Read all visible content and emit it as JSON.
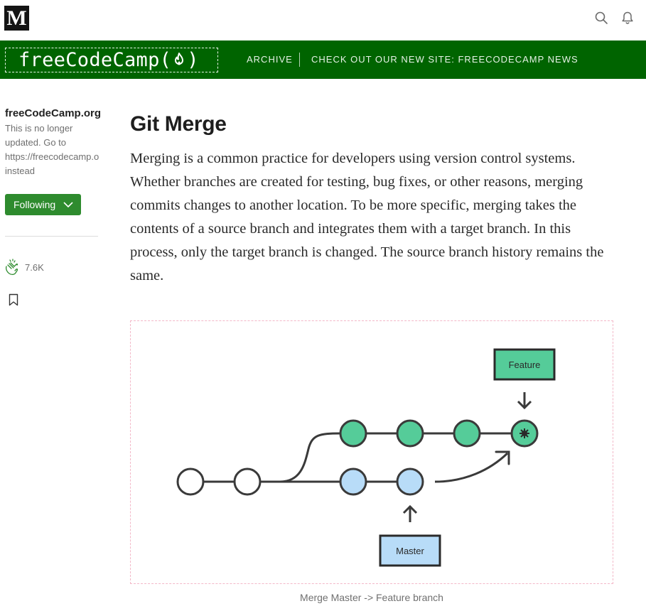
{
  "topbar": {
    "logo_letter": "M",
    "icons": [
      "search-icon",
      "bell-icon"
    ]
  },
  "navbar": {
    "brand_left": "freeCodeCamp(",
    "brand_right": ")",
    "brand_icon": "flame-icon",
    "links": [
      "ARCHIVE",
      "CHECK OUT OUR NEW SITE: FREECODECAMP NEWS"
    ],
    "color": "#006400"
  },
  "sidebar": {
    "publication": "freeCodeCamp.org",
    "description_lines": [
      "This is no longer",
      "updated. Go to",
      "https://freecodecamp.org/news",
      "instead"
    ],
    "follow_label": "Following",
    "clap_count": "7.6K",
    "accent": "#2e8b2e"
  },
  "article": {
    "title": "Git Merge",
    "paragraph": "Merging is a common practice for developers using version control systems. Whether branches are created for testing, bug fixes, or other reasons, merging commits changes to another location. To be more specific, merging takes the contents of a source branch and integrates them with a target branch. In this process, only the target branch is changed. The source branch history remains the same."
  },
  "figure": {
    "feature_label": "Feature",
    "master_label": "Master",
    "caption": "Merge Master -> Feature branch",
    "colors": {
      "feature": "#55cc99",
      "master": "#b8dcf8",
      "line": "#3a3a3a"
    }
  }
}
